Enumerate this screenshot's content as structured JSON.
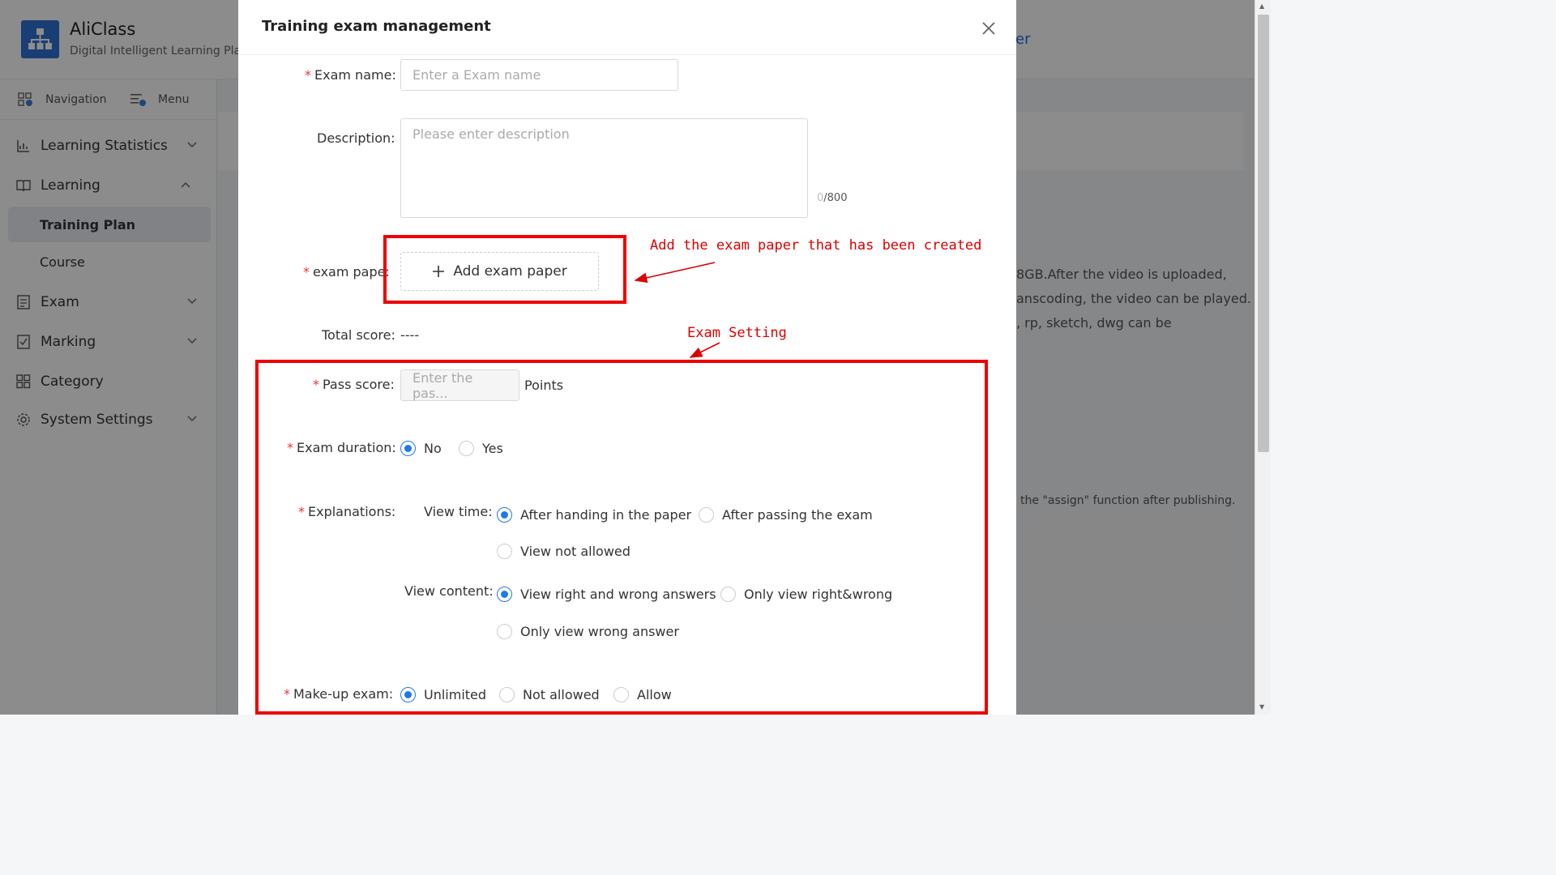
{
  "app": {
    "title": "AliClass",
    "subtitle": "Digital Intelligent Learning Platf",
    "header_right_fragment": "er",
    "brand_color": "#2f6fd6"
  },
  "sidebar": {
    "top": {
      "navigation": "Navigation",
      "menu": "Menu"
    },
    "items": [
      {
        "label": "Learning Statistics",
        "icon": "chart-icon",
        "expanded": false
      },
      {
        "label": "Learning",
        "icon": "book-icon",
        "expanded": true
      },
      {
        "label": "Exam",
        "icon": "exam-icon",
        "expanded": false
      },
      {
        "label": "Marking",
        "icon": "marking-icon",
        "expanded": false
      },
      {
        "label": "Category",
        "icon": "grid-icon"
      },
      {
        "label": "System Settings",
        "icon": "gear-icon",
        "expanded": false
      }
    ],
    "subitems": {
      "training_plan": "Training Plan",
      "course": "Course"
    }
  },
  "background": {
    "line1": "8GB.After the video is uploaded,",
    "line2": "anscoding, the video can be played.",
    "line3": ", rp, sketch, dwg can be",
    "line4": "the \"assign\" function after publishing."
  },
  "modal": {
    "title": "Training exam management",
    "exam_name": {
      "label": "Exam name",
      "placeholder": "Enter a Exam name"
    },
    "description": {
      "label": "Description",
      "placeholder": "Please enter description",
      "count": "0",
      "max": "/800"
    },
    "exam_paper": {
      "label": "exam pape",
      "button": "Add exam paper"
    },
    "total_score": {
      "label": "Total score",
      "value": "----"
    },
    "pass_score": {
      "label": "Pass score",
      "placeholder": "Enter the pas...",
      "unit": "Points"
    },
    "exam_duration": {
      "label": "Exam duration",
      "options": [
        "No",
        "Yes"
      ],
      "selected": "No"
    },
    "explanations": {
      "label": "Explanations",
      "view_time": {
        "label": "View time",
        "options": [
          "After handing in the paper",
          "After passing the exam",
          "View not allowed"
        ],
        "selected": "After handing in the paper"
      },
      "view_content": {
        "label": "View content",
        "options": [
          "View right and wrong answers",
          "Only view right&wrong",
          "Only view wrong answer"
        ],
        "selected": "View right and wrong answers"
      }
    },
    "makeup_exam": {
      "label": "Make-up exam",
      "options": [
        "Unlimited",
        "Not allowed",
        "Allow"
      ],
      "selected": "Unlimited"
    }
  },
  "annotations": {
    "paper_note": "Add the exam paper that has been created",
    "settings_note": "Exam Setting",
    "color": "#e00000"
  }
}
